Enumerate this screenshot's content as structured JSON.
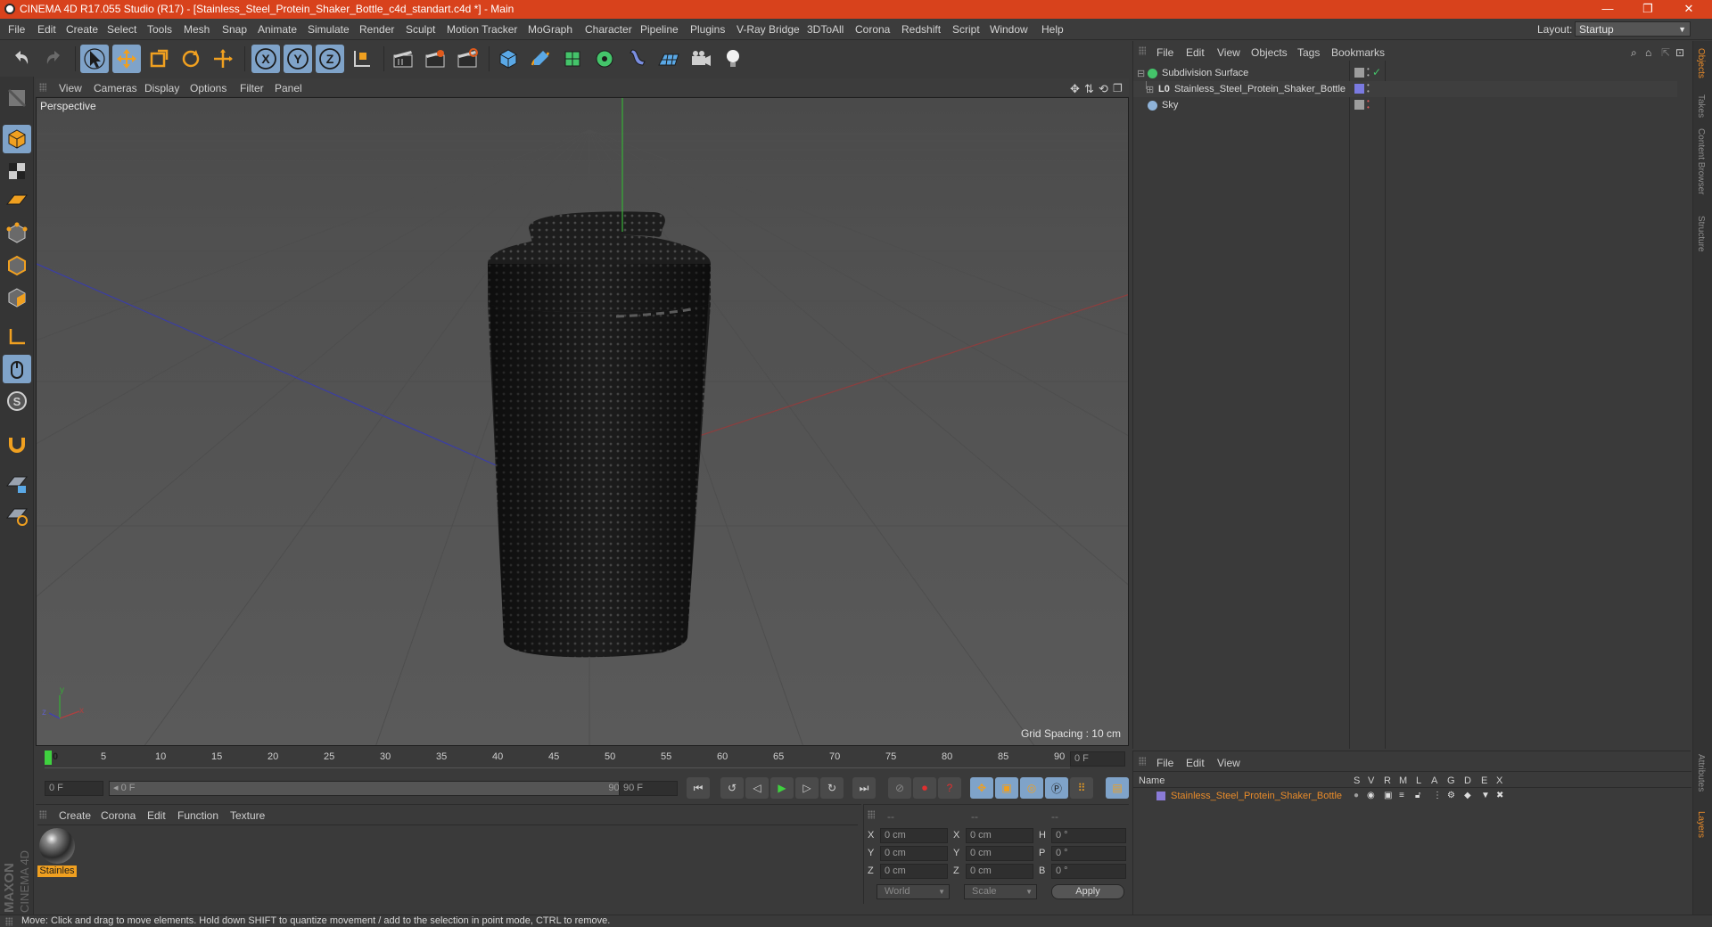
{
  "window": {
    "title": "CINEMA 4D R17.055 Studio (R17) - [Stainless_Steel_Protein_Shaker_Bottle_c4d_standart.c4d *] - Main",
    "minimize": "—",
    "restore": "❐",
    "close": "✕"
  },
  "menubar": {
    "items": [
      "File",
      "Edit",
      "Create",
      "Select",
      "Tools",
      "Mesh",
      "Snap",
      "Animate",
      "Simulate",
      "Render",
      "Sculpt",
      "Motion Tracker",
      "MoGraph",
      "Character",
      "Pipeline",
      "Plugins",
      "V-Ray Bridge",
      "3DToAll",
      "Corona",
      "Redshift",
      "Script",
      "Window",
      "Help"
    ],
    "layout_label": "Layout:",
    "layout_value": "Startup"
  },
  "viewport": {
    "menu": [
      "View",
      "Cameras",
      "Display",
      "Options",
      "Filter",
      "Panel"
    ],
    "title": "Perspective",
    "grid_spacing": "Grid Spacing : 10 cm",
    "axis_labels": {
      "y": "y",
      "x": "x",
      "z": "z"
    }
  },
  "timeline": {
    "ticks": [
      "0",
      "5",
      "10",
      "15",
      "20",
      "25",
      "30",
      "35",
      "40",
      "45",
      "50",
      "55",
      "60",
      "65",
      "70",
      "75",
      "80",
      "85",
      "90"
    ],
    "current_frame": "0 F",
    "start_frame": "0 F",
    "range_start": "◂ 0 F",
    "range_end": "90 F ▸",
    "end_frame": "90 F"
  },
  "material_panel": {
    "menu": [
      "Create",
      "Corona",
      "Edit",
      "Function",
      "Texture"
    ],
    "materials": [
      {
        "name": "Stainles"
      }
    ]
  },
  "coord_panel": {
    "headers": [
      "--",
      "--",
      "--"
    ],
    "rows": [
      {
        "axis": "X",
        "pos": "0 cm",
        "axis2": "X",
        "size": "0 cm",
        "axis3": "H",
        "rot": "0 °"
      },
      {
        "axis": "Y",
        "pos": "0 cm",
        "axis2": "Y",
        "size": "0 cm",
        "axis3": "P",
        "rot": "0 °"
      },
      {
        "axis": "Z",
        "pos": "0 cm",
        "axis2": "Z",
        "size": "0 cm",
        "axis3": "B",
        "rot": "0 °"
      }
    ],
    "mode1": "World",
    "mode2": "Scale",
    "apply": "Apply"
  },
  "object_panel": {
    "menu": [
      "File",
      "Edit",
      "View",
      "Objects",
      "Tags",
      "Bookmarks"
    ],
    "objects": [
      {
        "name": "Subdivision Surface",
        "color": "#44c46a"
      },
      {
        "name": "Stainless_Steel_Protein_Shaker_Bottle",
        "color": "#9c9c9c"
      },
      {
        "name": "Sky",
        "color": "#8fb3d9"
      }
    ]
  },
  "layer_panel": {
    "menu": [
      "File",
      "Edit",
      "View"
    ],
    "columns": [
      "Name",
      "S",
      "V",
      "R",
      "M",
      "L",
      "A",
      "G",
      "D",
      "E",
      "X"
    ],
    "layers": [
      {
        "name": "Stainless_Steel_Protein_Shaker_Bottle",
        "color": "#8a7bd8"
      }
    ]
  },
  "right_tabs": [
    "Objects",
    "Takes",
    "Content Browser",
    "Structure",
    "Attributes",
    "Layers"
  ],
  "status": "Move: Click and drag to move elements. Hold down SHIFT to quantize movement / add to the selection in point mode, CTRL to remove.",
  "brand": {
    "line1": "MAXON",
    "line2": "CINEMA 4D"
  },
  "colors": {
    "accent": "#d8421c",
    "selected": "#7fa3c9",
    "highlight": "#e88b2a"
  }
}
